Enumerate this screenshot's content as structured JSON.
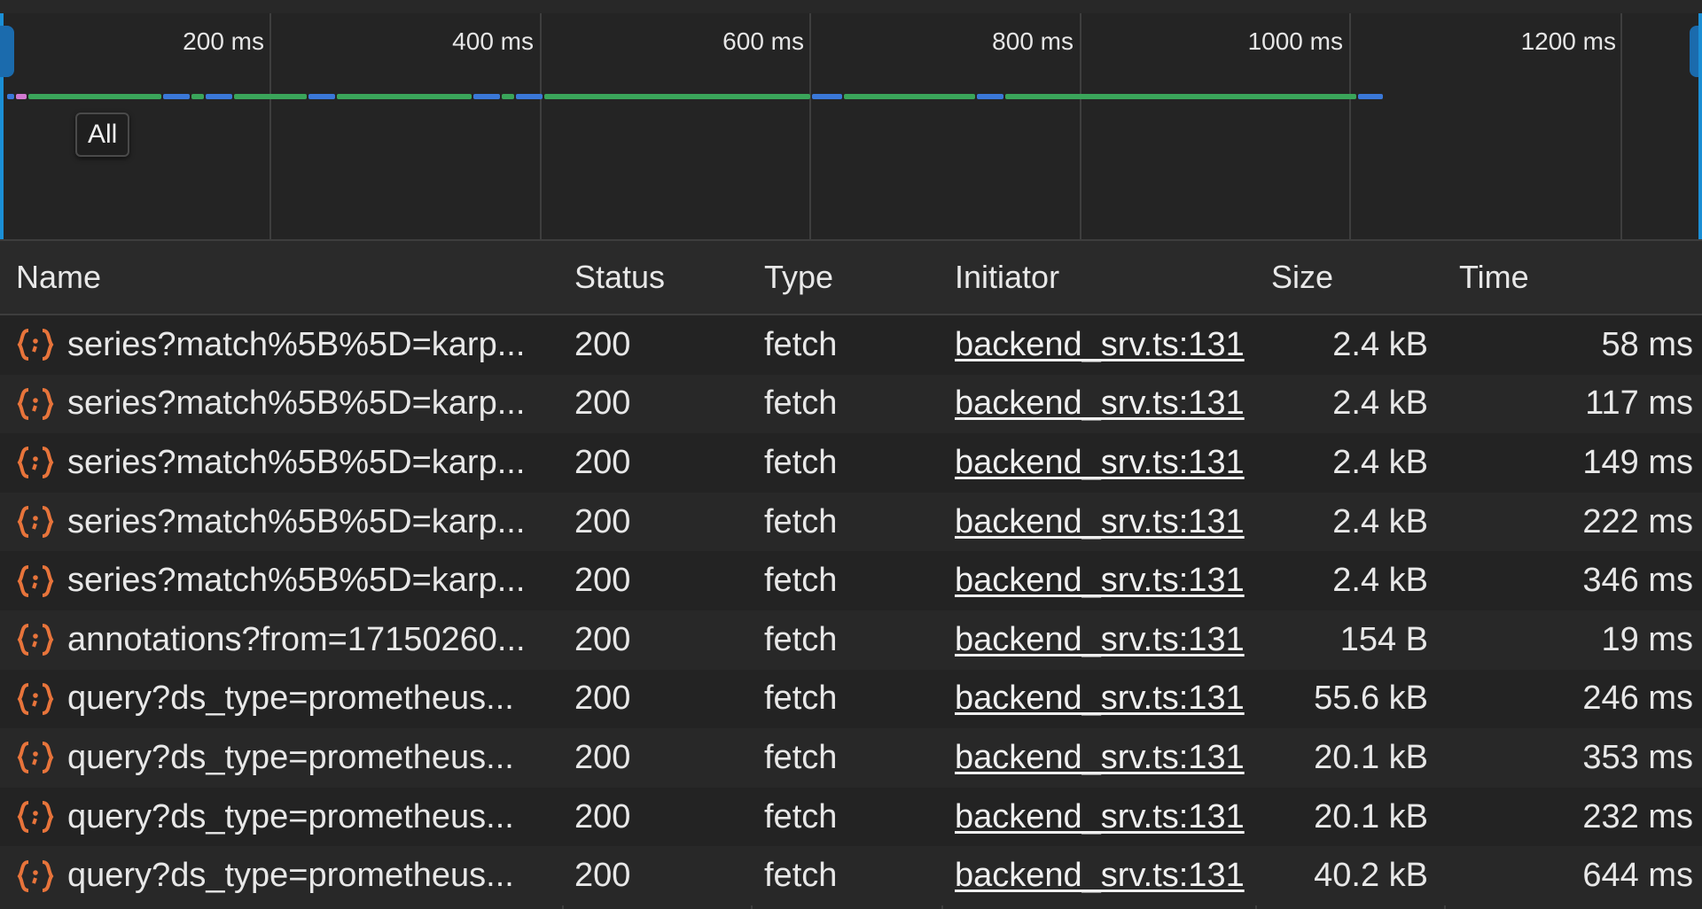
{
  "timeline": {
    "ticks": [
      "200 ms",
      "400 ms",
      "600 ms",
      "800 ms",
      "1000 ms",
      "1200 ms"
    ],
    "tooltip": "All",
    "colors": {
      "green": "#3aa55a",
      "blue": "#3a78d8",
      "pink": "#d07ad0"
    }
  },
  "table": {
    "columns": [
      "Name",
      "Status",
      "Type",
      "Initiator",
      "Size",
      "Time"
    ],
    "rows": [
      {
        "name": "series?match%5B%5D=karp...",
        "status": "200",
        "type": "fetch",
        "initiator": "backend_srv.ts:131",
        "size": "2.4 kB",
        "time": "58 ms"
      },
      {
        "name": "series?match%5B%5D=karp...",
        "status": "200",
        "type": "fetch",
        "initiator": "backend_srv.ts:131",
        "size": "2.4 kB",
        "time": "117 ms"
      },
      {
        "name": "series?match%5B%5D=karp...",
        "status": "200",
        "type": "fetch",
        "initiator": "backend_srv.ts:131",
        "size": "2.4 kB",
        "time": "149 ms"
      },
      {
        "name": "series?match%5B%5D=karp...",
        "status": "200",
        "type": "fetch",
        "initiator": "backend_srv.ts:131",
        "size": "2.4 kB",
        "time": "222 ms"
      },
      {
        "name": "series?match%5B%5D=karp...",
        "status": "200",
        "type": "fetch",
        "initiator": "backend_srv.ts:131",
        "size": "2.4 kB",
        "time": "346 ms"
      },
      {
        "name": "annotations?from=17150260...",
        "status": "200",
        "type": "fetch",
        "initiator": "backend_srv.ts:131",
        "size": "154 B",
        "time": "19 ms"
      },
      {
        "name": "query?ds_type=prometheus...",
        "status": "200",
        "type": "fetch",
        "initiator": "backend_srv.ts:131",
        "size": "55.6 kB",
        "time": "246 ms"
      },
      {
        "name": "query?ds_type=prometheus...",
        "status": "200",
        "type": "fetch",
        "initiator": "backend_srv.ts:131",
        "size": "20.1 kB",
        "time": "353 ms"
      },
      {
        "name": "query?ds_type=prometheus...",
        "status": "200",
        "type": "fetch",
        "initiator": "backend_srv.ts:131",
        "size": "20.1 kB",
        "time": "232 ms"
      },
      {
        "name": "query?ds_type=prometheus...",
        "status": "200",
        "type": "fetch",
        "initiator": "backend_srv.ts:131",
        "size": "40.2 kB",
        "time": "644 ms"
      }
    ]
  }
}
